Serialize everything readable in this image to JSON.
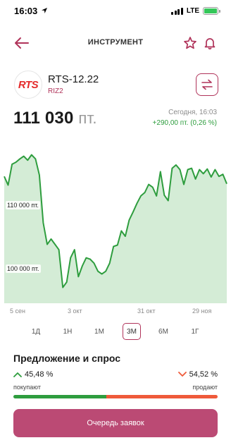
{
  "status_bar": {
    "time": "16:03",
    "network": "LTE",
    "icons": [
      "location-arrow-icon",
      "signal-icon",
      "battery-charging-icon"
    ]
  },
  "header": {
    "title": "ИНСТРУМЕНТ",
    "icons": [
      "back-arrow-icon",
      "star-icon",
      "bell-icon"
    ],
    "accent_color": "#b0335a"
  },
  "instrument": {
    "logo_text": "RTS",
    "name": "RTS-12.22",
    "ticker": "RIZ2",
    "swap_icon": "swap-arrows-icon"
  },
  "price": {
    "value": "111 030",
    "unit": "пт.",
    "change_date": "Сегодня, 16:03",
    "change_value": "+290,00 пт. (0,26 %)",
    "change_color": "#2e9d3e"
  },
  "chart_data": {
    "type": "area",
    "y_tick_labels": [
      "110 000 пт.",
      "100 000 пт."
    ],
    "x_tick_labels": [
      "5 сен",
      "3 окт",
      "31 окт",
      "29 ноя"
    ],
    "values": [
      113800,
      112500,
      115600,
      115900,
      116400,
      116800,
      116200,
      117000,
      116400,
      114000,
      106900,
      103700,
      104500,
      103700,
      102900,
      97300,
      98100,
      101700,
      102900,
      98900,
      100500,
      101700,
      101500,
      100900,
      99700,
      99300,
      99700,
      100900,
      103400,
      103600,
      105700,
      104900,
      107300,
      108500,
      109800,
      110900,
      111400,
      112600,
      112200,
      110900,
      114500,
      111000,
      110200,
      115000,
      115500,
      114800,
      112600,
      114800,
      115000,
      113400,
      114800,
      114200,
      114900,
      113700,
      114800,
      113800,
      114100,
      112700
    ],
    "ylim": [
      96000,
      118000
    ],
    "line_color": "#2e9d3e",
    "fill_color": "#d4ecd6"
  },
  "periods": {
    "items": [
      "1Д",
      "1Н",
      "1М",
      "3М",
      "6М",
      "1Г"
    ],
    "selected": "3М"
  },
  "supply_demand": {
    "title": "Предложение и спрос",
    "buy_percent": "45,48 %",
    "sell_percent": "54,52 %",
    "buy_label": "покупают",
    "sell_label": "продают",
    "buy_share": 0.4548,
    "buy_color": "#2e9d3e",
    "sell_color": "#ef5a3a",
    "buy_icon": "chevron-up-icon",
    "sell_icon": "chevron-down-icon"
  },
  "actions": {
    "queue_label": "Очередь заявок",
    "button_color": "#bb4a74"
  }
}
